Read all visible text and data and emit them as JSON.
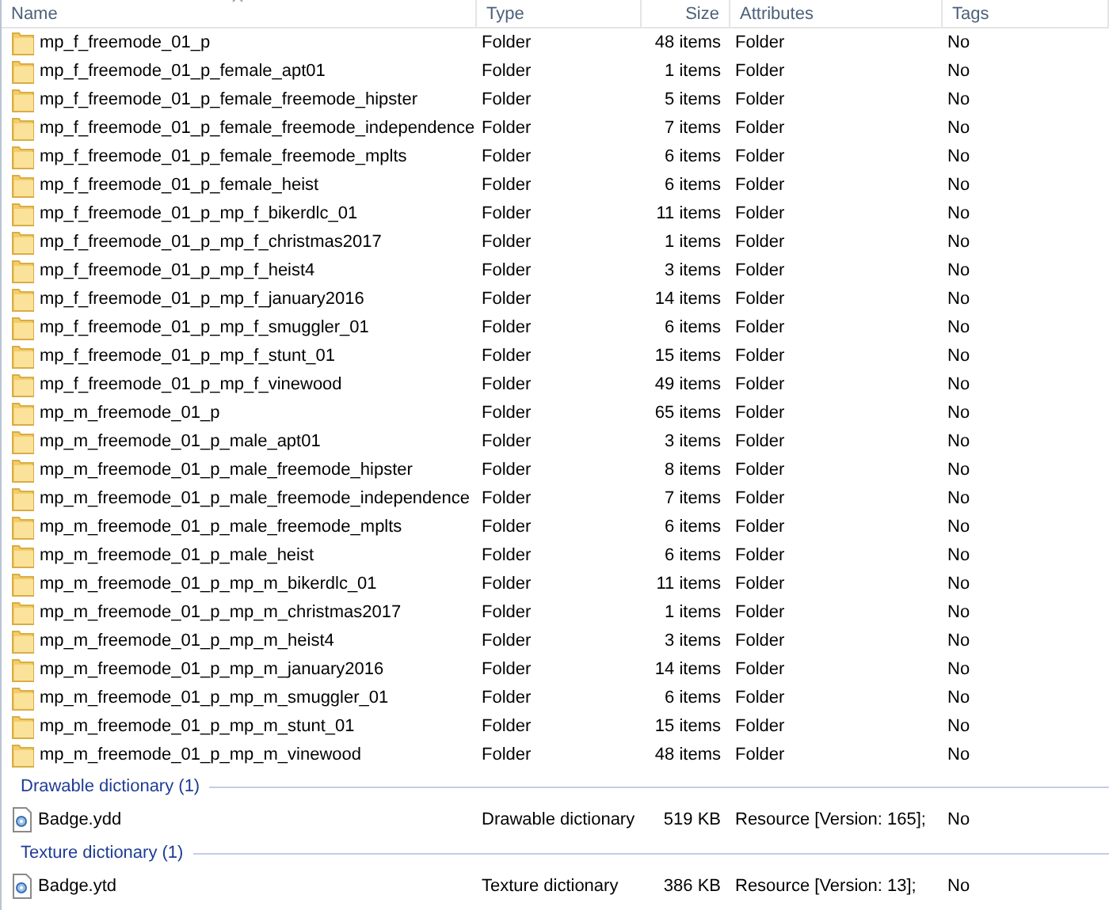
{
  "table": {
    "columns": [
      {
        "label": "Name"
      },
      {
        "label": "Type"
      },
      {
        "label": "Size"
      },
      {
        "label": "Attributes"
      },
      {
        "label": "Tags"
      }
    ],
    "groups": [
      {
        "rows": [
          {
            "kind": "folder",
            "name": "mp_f_freemode_01_p",
            "type": "Folder",
            "size": "48 items",
            "attributes": "Folder",
            "tags": "No"
          },
          {
            "kind": "folder",
            "name": "mp_f_freemode_01_p_female_apt01",
            "type": "Folder",
            "size": "1 items",
            "attributes": "Folder",
            "tags": "No"
          },
          {
            "kind": "folder",
            "name": "mp_f_freemode_01_p_female_freemode_hipster",
            "type": "Folder",
            "size": "5 items",
            "attributes": "Folder",
            "tags": "No"
          },
          {
            "kind": "folder",
            "name": "mp_f_freemode_01_p_female_freemode_independence",
            "type": "Folder",
            "size": "7 items",
            "attributes": "Folder",
            "tags": "No"
          },
          {
            "kind": "folder",
            "name": "mp_f_freemode_01_p_female_freemode_mplts",
            "type": "Folder",
            "size": "6 items",
            "attributes": "Folder",
            "tags": "No"
          },
          {
            "kind": "folder",
            "name": "mp_f_freemode_01_p_female_heist",
            "type": "Folder",
            "size": "6 items",
            "attributes": "Folder",
            "tags": "No"
          },
          {
            "kind": "folder",
            "name": "mp_f_freemode_01_p_mp_f_bikerdlc_01",
            "type": "Folder",
            "size": "11 items",
            "attributes": "Folder",
            "tags": "No"
          },
          {
            "kind": "folder",
            "name": "mp_f_freemode_01_p_mp_f_christmas2017",
            "type": "Folder",
            "size": "1 items",
            "attributes": "Folder",
            "tags": "No"
          },
          {
            "kind": "folder",
            "name": "mp_f_freemode_01_p_mp_f_heist4",
            "type": "Folder",
            "size": "3 items",
            "attributes": "Folder",
            "tags": "No"
          },
          {
            "kind": "folder",
            "name": "mp_f_freemode_01_p_mp_f_january2016",
            "type": "Folder",
            "size": "14 items",
            "attributes": "Folder",
            "tags": "No"
          },
          {
            "kind": "folder",
            "name": "mp_f_freemode_01_p_mp_f_smuggler_01",
            "type": "Folder",
            "size": "6 items",
            "attributes": "Folder",
            "tags": "No"
          },
          {
            "kind": "folder",
            "name": "mp_f_freemode_01_p_mp_f_stunt_01",
            "type": "Folder",
            "size": "15 items",
            "attributes": "Folder",
            "tags": "No"
          },
          {
            "kind": "folder",
            "name": "mp_f_freemode_01_p_mp_f_vinewood",
            "type": "Folder",
            "size": "49 items",
            "attributes": "Folder",
            "tags": "No"
          },
          {
            "kind": "folder",
            "name": "mp_m_freemode_01_p",
            "type": "Folder",
            "size": "65 items",
            "attributes": "Folder",
            "tags": "No"
          },
          {
            "kind": "folder",
            "name": "mp_m_freemode_01_p_male_apt01",
            "type": "Folder",
            "size": "3 items",
            "attributes": "Folder",
            "tags": "No"
          },
          {
            "kind": "folder",
            "name": "mp_m_freemode_01_p_male_freemode_hipster",
            "type": "Folder",
            "size": "8 items",
            "attributes": "Folder",
            "tags": "No"
          },
          {
            "kind": "folder",
            "name": "mp_m_freemode_01_p_male_freemode_independence",
            "type": "Folder",
            "size": "7 items",
            "attributes": "Folder",
            "tags": "No"
          },
          {
            "kind": "folder",
            "name": "mp_m_freemode_01_p_male_freemode_mplts",
            "type": "Folder",
            "size": "6 items",
            "attributes": "Folder",
            "tags": "No"
          },
          {
            "kind": "folder",
            "name": "mp_m_freemode_01_p_male_heist",
            "type": "Folder",
            "size": "6 items",
            "attributes": "Folder",
            "tags": "No"
          },
          {
            "kind": "folder",
            "name": "mp_m_freemode_01_p_mp_m_bikerdlc_01",
            "type": "Folder",
            "size": "11 items",
            "attributes": "Folder",
            "tags": "No"
          },
          {
            "kind": "folder",
            "name": "mp_m_freemode_01_p_mp_m_christmas2017",
            "type": "Folder",
            "size": "1 items",
            "attributes": "Folder",
            "tags": "No"
          },
          {
            "kind": "folder",
            "name": "mp_m_freemode_01_p_mp_m_heist4",
            "type": "Folder",
            "size": "3 items",
            "attributes": "Folder",
            "tags": "No"
          },
          {
            "kind": "folder",
            "name": "mp_m_freemode_01_p_mp_m_january2016",
            "type": "Folder",
            "size": "14 items",
            "attributes": "Folder",
            "tags": "No"
          },
          {
            "kind": "folder",
            "name": "mp_m_freemode_01_p_mp_m_smuggler_01",
            "type": "Folder",
            "size": "6 items",
            "attributes": "Folder",
            "tags": "No"
          },
          {
            "kind": "folder",
            "name": "mp_m_freemode_01_p_mp_m_stunt_01",
            "type": "Folder",
            "size": "15 items",
            "attributes": "Folder",
            "tags": "No"
          },
          {
            "kind": "folder",
            "name": "mp_m_freemode_01_p_mp_m_vinewood",
            "type": "Folder",
            "size": "48 items",
            "attributes": "Folder",
            "tags": "No"
          }
        ]
      },
      {
        "title": "Drawable dictionary (1)",
        "rows": [
          {
            "kind": "file",
            "name": "Badge.ydd",
            "type": "Drawable dictionary",
            "size": "519 KB",
            "attributes": "Resource [Version: 165];",
            "tags": "No"
          }
        ]
      },
      {
        "title": "Texture dictionary (1)",
        "rows": [
          {
            "kind": "file",
            "name": "Badge.ytd",
            "type": "Texture dictionary",
            "size": "386 KB",
            "attributes": "Resource [Version: 13];",
            "tags": "No"
          }
        ]
      }
    ]
  }
}
